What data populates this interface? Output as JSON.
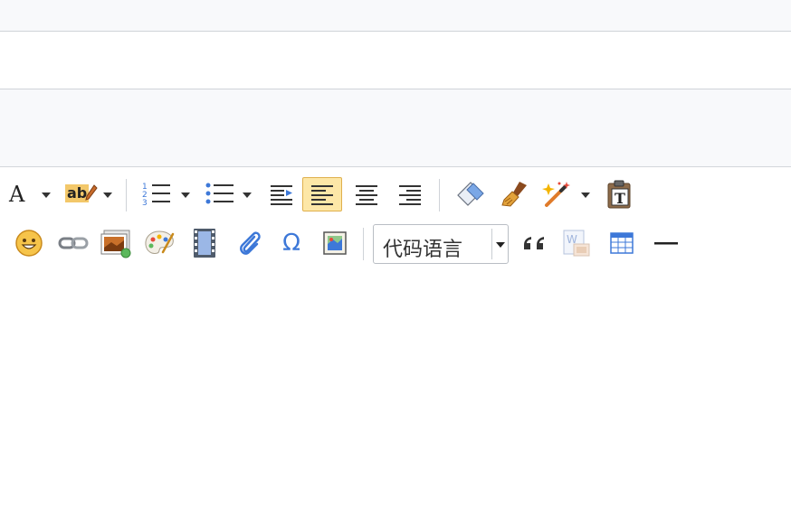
{
  "toolbar": {
    "code_language_label": "代码语言",
    "font_color_glyph": "A",
    "highlight_glyph": "ab",
    "special_char_glyph": "Ω",
    "quote_glyph": "❝"
  },
  "colors": {
    "active_bg": "#fde7a7",
    "active_border": "#e0b04d",
    "icon_blue": "#3d78d8"
  }
}
